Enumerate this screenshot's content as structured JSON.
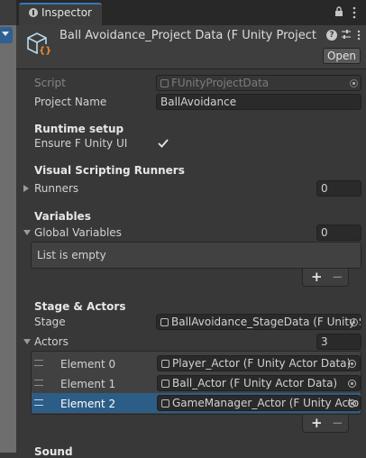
{
  "tab": {
    "title": "Inspector",
    "icon": "info-icon"
  },
  "header": {
    "title": "Ball Avoidance_Project Data (F Unity Project Data)",
    "open_label": "Open",
    "icons": [
      "asset-icon",
      "help-icon",
      "settings-icon",
      "more-icon"
    ]
  },
  "script": {
    "label": "Script",
    "value": "FUnityProjectData"
  },
  "project_name": {
    "label": "Project Name",
    "value": "BallAvoidance"
  },
  "runtime": {
    "heading": "Runtime setup",
    "ensure_label": "Ensure F Unity UI",
    "ensure_checked": true
  },
  "vs_runners": {
    "heading": "Visual Scripting Runners",
    "runners_label": "Runners",
    "runners_count": "0"
  },
  "variables": {
    "heading": "Variables",
    "global_label": "Global Variables",
    "global_count": "0",
    "empty_text": "List is empty"
  },
  "stage_actors": {
    "heading": "Stage & Actors",
    "stage_label": "Stage",
    "stage_value": "BallAvoidance_StageData (F Unity Stage Data)",
    "actors_label": "Actors",
    "actors_count": "3",
    "elements": [
      {
        "label": "Element 0",
        "value": "Player_Actor (F Unity Actor Data)"
      },
      {
        "label": "Element 1",
        "value": "Ball_Actor (F Unity Actor Data)"
      },
      {
        "label": "Element 2",
        "value": "GameManager_Actor (F Unity Actor Data)"
      }
    ],
    "selected_index": 2
  },
  "sound": {
    "heading": "Sound"
  },
  "list_buttons": {
    "add": "+",
    "remove": "−"
  },
  "colors": {
    "accent": "#3a79bb",
    "selection": "#2c5d87",
    "background": "#383838"
  }
}
